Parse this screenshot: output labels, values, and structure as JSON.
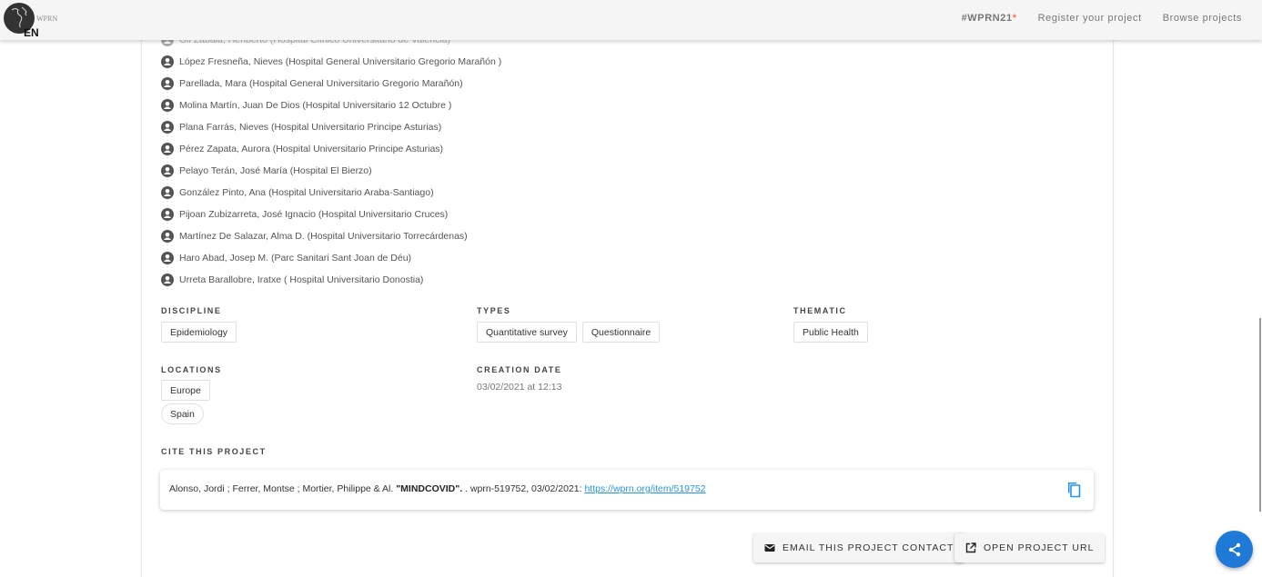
{
  "header": {
    "logo_text": "WPRN",
    "language": "EN",
    "nav": {
      "hashtag": "#WPRN21",
      "hashtag_star": "*",
      "register": "Register your project",
      "browse": "Browse projects"
    }
  },
  "people": [
    "Gil Zabala, Heriberto (Hospital Clínico Universitario de Valencia)",
    "López Fresneña, Nieves (Hospital General Universitario Gregorio Marañón )",
    "Parellada, Mara (Hospital General Universitario Gregorio Marañón)",
    "Molina Martín, Juan De Dios (Hospital Universitario 12 Octubre )",
    "Plana Farrás, Nieves (Hospital Universitario Principe Asturias)",
    "Pérez Zapata, Aurora (Hospital Universitario Principe Asturias)",
    "Pelayo Terán, José María (Hospital El Bierzo)",
    "González Pinto, Ana (Hospital Universitario Araba-Santiago)",
    "Pijoan Zubizarreta, José Ignacio (Hospital Universitario Cruces)",
    "Martínez De Salazar, Alma D. (Hospital Universitario Torrecárdenas)",
    "Haro Abad, Josep M. (Parc Sanitari Sant Joan de Déu)",
    "Urreta Barallobre, Iratxe ( Hospital Universitario Donostia)"
  ],
  "discipline": {
    "label": "DISCIPLINE",
    "items": [
      "Epidemiology"
    ]
  },
  "types": {
    "label": "TYPES",
    "items": [
      "Quantitative survey",
      "Questionnaire"
    ]
  },
  "thematic": {
    "label": "THEMATIC",
    "items": [
      "Public Health"
    ]
  },
  "locations": {
    "label": "LOCATIONS",
    "items": [
      "Europe",
      "Spain"
    ]
  },
  "creation_date": {
    "label": "CREATION DATE",
    "value": "03/02/2021 at 12:13"
  },
  "cite": {
    "label": "CITE THIS PROJECT",
    "authors": "Alonso, Jordi ; Ferrer, Montse ; Mortier, Philippe & Al.",
    "title": "\"MINDCOVID\".",
    "rest": ". wprn-519752, 03/02/2021:",
    "url": "https://wprn.org/item/519752"
  },
  "buttons": {
    "email": "EMAIL THIS PROJECT CONTACT",
    "open_url": "OPEN PROJECT URL"
  },
  "colors": {
    "accent": "#1e7ad6",
    "link": "#2196f3",
    "star": "#f07a3c"
  }
}
